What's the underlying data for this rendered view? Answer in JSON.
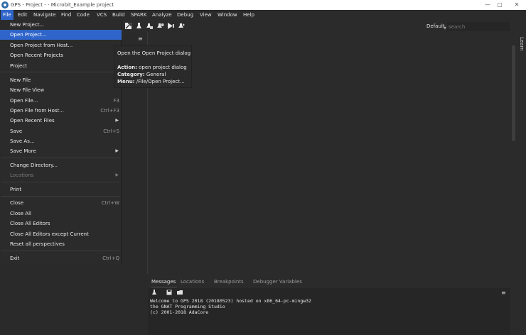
{
  "window": {
    "title": "GPS - Project - - Microbit_Example project",
    "minimize": "—",
    "maximize": "▢",
    "close": "✕"
  },
  "menubar": [
    "File",
    "Edit",
    "Navigate",
    "Find",
    "Code",
    "VCS",
    "Build",
    "SPARK",
    "Analyze",
    "Debug",
    "View",
    "Window",
    "Help"
  ],
  "toolbar": {
    "perspective": "Default",
    "search_placeholder": "search",
    "icons": [
      "load-project-icon",
      "build-icon",
      "build-all-icon",
      "clean-icon",
      "debug-run-icon",
      "run-icon"
    ]
  },
  "file_menu": {
    "items": [
      {
        "label": "New Project...",
        "shortcut": "",
        "submenu": false,
        "disabled": false
      },
      {
        "label": "Open Project...",
        "shortcut": "",
        "submenu": false,
        "disabled": false,
        "highlight": true
      },
      {
        "label": "Open Project from Host...",
        "shortcut": "",
        "submenu": false,
        "disabled": false
      },
      {
        "label": "Open Recent Projects",
        "shortcut": "",
        "submenu": false,
        "disabled": false
      },
      {
        "label": "Project",
        "shortcut": "",
        "submenu": false,
        "disabled": false
      },
      {
        "label": "New File",
        "shortcut": "",
        "submenu": false,
        "disabled": false
      },
      {
        "label": "New File View",
        "shortcut": "",
        "submenu": false,
        "disabled": false
      },
      {
        "label": "Open File...",
        "shortcut": "F3",
        "submenu": false,
        "disabled": false
      },
      {
        "label": "Open File from Host...",
        "shortcut": "Ctrl+F3",
        "submenu": false,
        "disabled": false
      },
      {
        "label": "Open Recent Files",
        "shortcut": "",
        "submenu": true,
        "disabled": false
      },
      {
        "label": "Save",
        "shortcut": "Ctrl+S",
        "submenu": false,
        "disabled": false
      },
      {
        "label": "Save As...",
        "shortcut": "",
        "submenu": false,
        "disabled": false
      },
      {
        "label": "Save More",
        "shortcut": "",
        "submenu": true,
        "disabled": false
      },
      {
        "label": "Change Directory...",
        "shortcut": "",
        "submenu": false,
        "disabled": false
      },
      {
        "label": "Locations",
        "shortcut": "",
        "submenu": true,
        "disabled": true
      },
      {
        "label": "Print",
        "shortcut": "",
        "submenu": false,
        "disabled": false
      },
      {
        "label": "Close",
        "shortcut": "Ctrl+W",
        "submenu": false,
        "disabled": false
      },
      {
        "label": "Close All",
        "shortcut": "",
        "submenu": false,
        "disabled": false
      },
      {
        "label": "Close All Editors",
        "shortcut": "",
        "submenu": false,
        "disabled": false
      },
      {
        "label": "Close All Editors except Current",
        "shortcut": "",
        "submenu": false,
        "disabled": false
      },
      {
        "label": "Reset all perspectives",
        "shortcut": "",
        "submenu": false,
        "disabled": false
      },
      {
        "label": "Exit",
        "shortcut": "Ctrl+Q",
        "submenu": false,
        "disabled": false
      }
    ]
  },
  "tooltip": {
    "title": "Open the Open Project dialog",
    "action_label": "Action:",
    "action_value": "open project dialog",
    "category_label": "Category:",
    "category_value": "General",
    "menu_label": "Menu:",
    "menu_value": "/File/Open Project..."
  },
  "side_tab": "Learn",
  "bottom": {
    "tabs": [
      "Messages",
      "Locations",
      "Breakpoints",
      "Debugger Variables"
    ],
    "console": [
      "Welcome to GPS 2018 (20180523) hosted on x86_64-pc-mingw32",
      "the GNAT Programming Studio",
      "(c) 2001-2018 AdaCore"
    ]
  },
  "colors": {
    "accent": "#2f65ca",
    "background": "#2b2b2b"
  }
}
